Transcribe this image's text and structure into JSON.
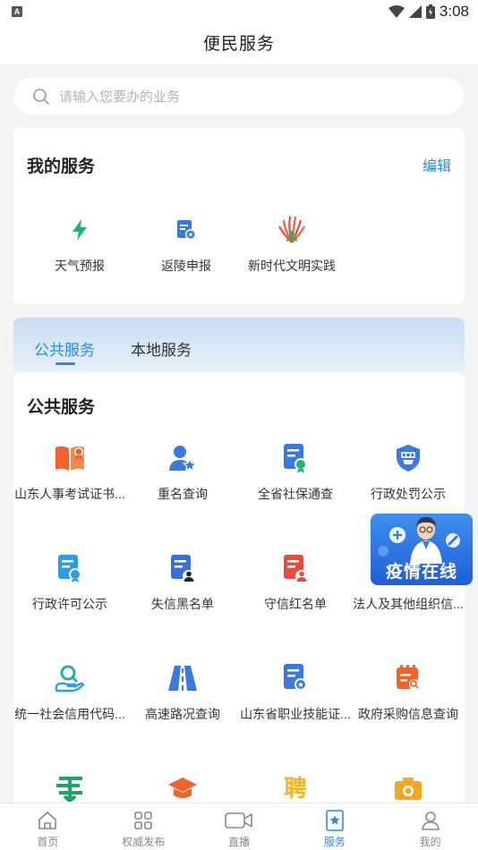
{
  "status_bar": {
    "left_badge": "A",
    "time": "3:08"
  },
  "header": {
    "title": "便民服务"
  },
  "search": {
    "placeholder": "请输入您要办的业务"
  },
  "my_services": {
    "title": "我的服务",
    "edit_label": "编辑",
    "items": [
      {
        "label": "天气预报",
        "icon": "lightning-icon"
      },
      {
        "label": "返陵申报",
        "icon": "document-badge-icon"
      },
      {
        "label": "新时代文明实践",
        "icon": "fan-emblem-icon"
      }
    ]
  },
  "tabs": {
    "active": "公共服务",
    "inactive": "本地服务"
  },
  "public_services": {
    "title": "公共服务",
    "items": [
      {
        "label": "山东人事考试证书...",
        "icon": "book-certificate-icon"
      },
      {
        "label": "重名查询",
        "icon": "user-star-icon"
      },
      {
        "label": "全省社保通查",
        "icon": "document-seal-icon"
      },
      {
        "label": "行政处罚公示",
        "icon": "shield-penalty-icon"
      },
      {
        "label": "行政许可公示",
        "icon": "permit-icon"
      },
      {
        "label": "失信黑名单",
        "icon": "blacklist-icon"
      },
      {
        "label": "守信红名单",
        "icon": "redlist-icon"
      },
      {
        "label": "法人及其他组织信...",
        "icon": "organization-icon"
      },
      {
        "label": "统一社会信用代码...",
        "icon": "hand-search-icon"
      },
      {
        "label": "高速路况查询",
        "icon": "road-icon"
      },
      {
        "label": "山东省职业技能证...",
        "icon": "skill-certificate-icon"
      },
      {
        "label": "政府采购信息查询",
        "icon": "calendar-search-icon"
      },
      {
        "label": "",
        "icon": "post-icon"
      },
      {
        "label": "",
        "icon": "graduation-cap-icon"
      },
      {
        "label": "",
        "icon": "recruit-icon"
      },
      {
        "label": "",
        "icon": "camera-icon"
      }
    ],
    "recruit_glyph": "聘"
  },
  "float_banner": {
    "text": "疫情在线"
  },
  "bottom_nav": [
    {
      "label": "首页",
      "icon": "home-icon",
      "active": false
    },
    {
      "label": "权威发布",
      "icon": "grid-icon",
      "active": false
    },
    {
      "label": "直播",
      "icon": "video-camera-icon",
      "active": false
    },
    {
      "label": "服务",
      "icon": "star-bookmark-icon",
      "active": true
    },
    {
      "label": "我的",
      "icon": "person-icon",
      "active": false
    }
  ],
  "colors": {
    "accent": "#2c8ae6",
    "orange": "#f2632a",
    "blue": "#3a7ae0",
    "green": "#22b07d",
    "red": "#e94b3c"
  }
}
